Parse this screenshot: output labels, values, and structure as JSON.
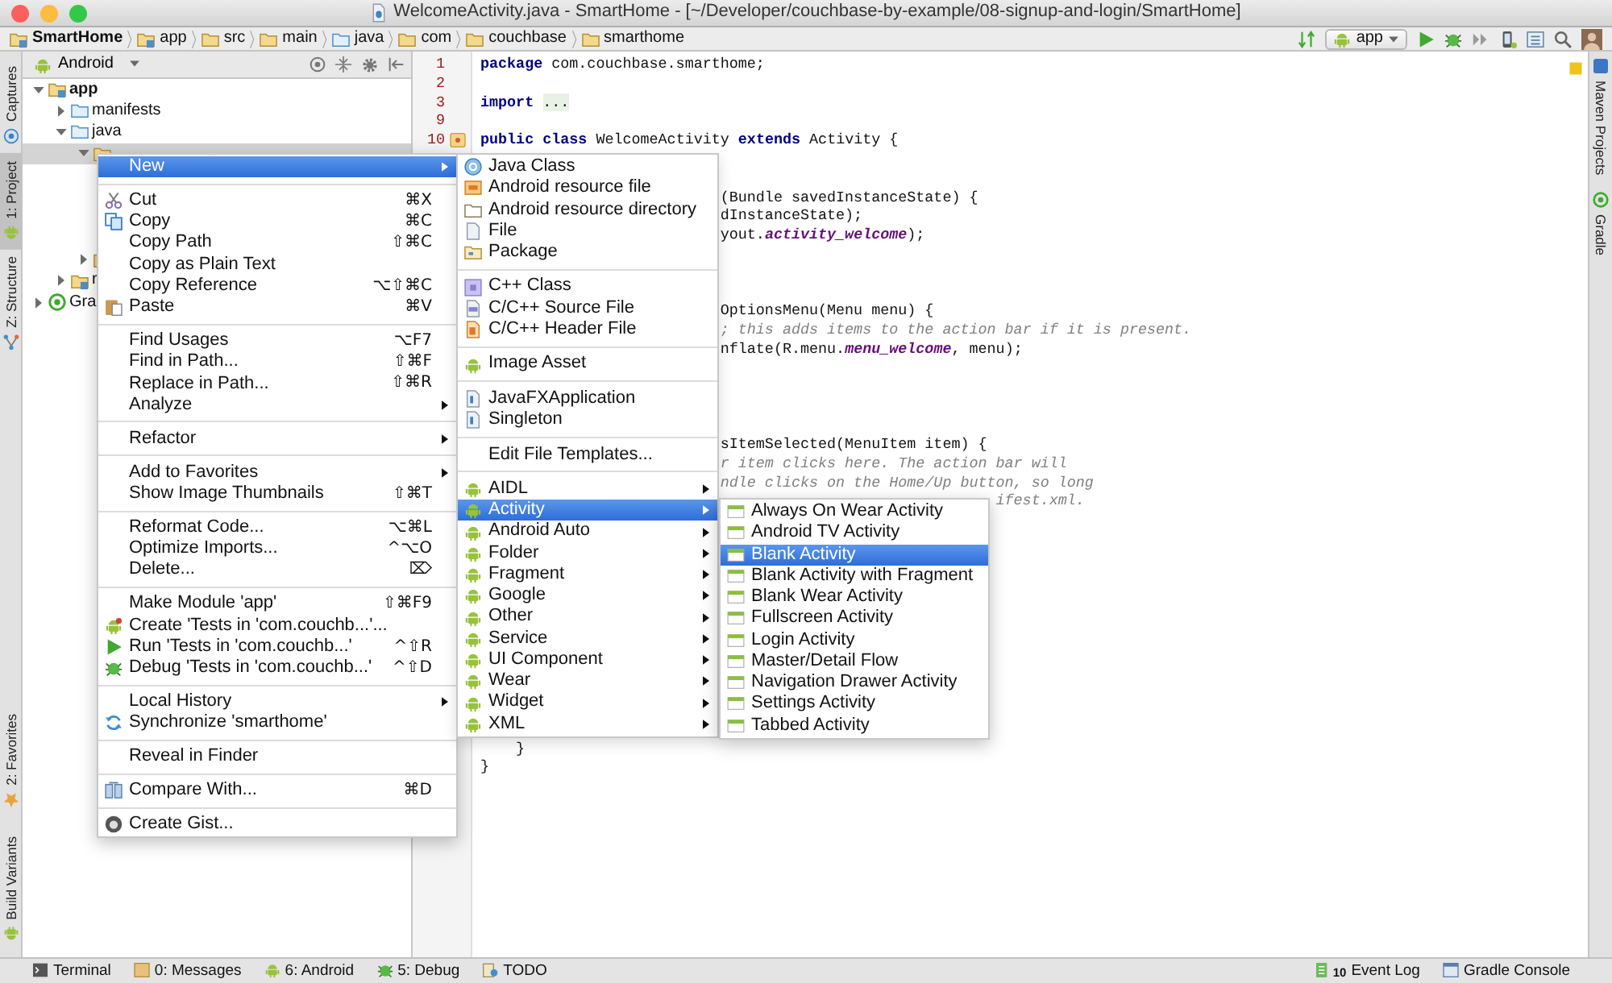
{
  "window": {
    "title": "WelcomeActivity.java - SmartHome - [~/Developer/couchbase-by-example/08-signup-and-login/SmartHome]"
  },
  "breadcrumbs": [
    {
      "label": "SmartHome",
      "kind": "project"
    },
    {
      "label": "app",
      "kind": "module"
    },
    {
      "label": "src",
      "kind": "folder"
    },
    {
      "label": "main",
      "kind": "folder"
    },
    {
      "label": "java",
      "kind": "source"
    },
    {
      "label": "com",
      "kind": "package"
    },
    {
      "label": "couchbase",
      "kind": "package"
    },
    {
      "label": "smarthome",
      "kind": "package"
    }
  ],
  "toolbar": {
    "run_configuration": "app"
  },
  "left_tool_tabs": [
    {
      "label": "Captures",
      "selected": false
    },
    {
      "label": "1: Project",
      "selected": true
    },
    {
      "label": "Z: Structure",
      "selected": false
    }
  ],
  "left_tool_tabs_lower": [
    {
      "label": "2: Favorites",
      "selected": false
    },
    {
      "label": "Build Variants",
      "selected": false
    }
  ],
  "right_tool_tabs": [
    {
      "label": "Maven Projects"
    },
    {
      "label": "Gradle"
    }
  ],
  "project_panel": {
    "view": "Android",
    "tree": [
      {
        "label": "app",
        "kind": "module",
        "expanded": true,
        "selected": false,
        "children": [
          {
            "label": "manifests",
            "kind": "folder",
            "expanded": false,
            "selected": false
          },
          {
            "label": "java",
            "kind": "folder",
            "expanded": true,
            "selected": false,
            "children": [
              {
                "kind": "package",
                "expanded": true,
                "selected": true
              },
              {
                "kind": "package",
                "expanded": false,
                "selected": false
              }
            ]
          },
          {
            "label": "r",
            "kind": "res",
            "expanded": false,
            "selected": false
          }
        ]
      },
      {
        "label": "Gra",
        "kind": "gradle",
        "expanded": false,
        "selected": false
      }
    ]
  },
  "editor": {
    "line_numbers": [
      "1",
      "2",
      "3",
      "9",
      "10"
    ],
    "lines": [
      {
        "tokens": [
          {
            "text": "package",
            "kind": "keyword"
          },
          {
            "text": " com.couchbase.smarthome;",
            "kind": "plain"
          }
        ]
      },
      {
        "tokens": [
          {
            "text": "import ",
            "kind": "keyword"
          },
          {
            "text": "...",
            "kind": "folded"
          }
        ]
      },
      {
        "tokens": [
          {
            "text": "public ",
            "kind": "keyword"
          },
          {
            "text": "class",
            "kind": "keyword"
          },
          {
            "text": " WelcomeActivity ",
            "kind": "plain"
          },
          {
            "text": "extends",
            "kind": "keyword"
          },
          {
            "text": " Activity {",
            "kind": "plain"
          }
        ]
      },
      {
        "tokens": [
          {
            "text": "(Bundle savedInstanceState) {",
            "kind": "plain"
          }
        ]
      },
      {
        "tokens": [
          {
            "text": "dInstanceState);",
            "kind": "plain"
          }
        ]
      },
      {
        "tokens": [
          {
            "text": "yout.",
            "kind": "plain"
          },
          {
            "text": "activity_welcome",
            "kind": "field"
          },
          {
            "text": ");",
            "kind": "plain"
          }
        ]
      },
      {
        "tokens": [
          {
            "text": "OptionsMenu(Menu menu) {",
            "kind": "plain"
          }
        ]
      },
      {
        "tokens": [
          {
            "text": "; this adds items to the action bar if it is present.",
            "kind": "comment"
          }
        ]
      },
      {
        "tokens": [
          {
            "text": "nflate(R.menu.",
            "kind": "plain"
          },
          {
            "text": "menu_welcome",
            "kind": "field"
          },
          {
            "text": ", menu);",
            "kind": "plain"
          }
        ]
      },
      {
        "tokens": [
          {
            "text": "sItemSelected(MenuItem item) {",
            "kind": "plain"
          }
        ]
      },
      {
        "tokens": [
          {
            "text": "r item clicks here. The action bar will",
            "kind": "comment"
          }
        ]
      },
      {
        "tokens": [
          {
            "text": "ndle clicks on the Home/Up button, so long",
            "kind": "comment"
          }
        ]
      },
      {
        "tokens": [
          {
            "text": "ifest.xml.",
            "kind": "comment"
          }
        ]
      },
      {
        "tokens": [
          {
            "text": "}",
            "kind": "plain"
          }
        ]
      },
      {
        "tokens": [
          {
            "text": "}",
            "kind": "plain"
          }
        ]
      }
    ]
  },
  "context_menu": {
    "items": [
      {
        "kind": "item",
        "label": "New",
        "submenu": true,
        "selected": true
      },
      {
        "kind": "separator"
      },
      {
        "kind": "item",
        "label": "Cut",
        "shortcut": "⌘X",
        "submenu": false,
        "selected": false
      },
      {
        "kind": "item",
        "label": "Copy",
        "shortcut": "⌘C",
        "submenu": false,
        "selected": false
      },
      {
        "kind": "item",
        "label": "Copy Path",
        "shortcut": "⇧⌘C",
        "submenu": false,
        "selected": false
      },
      {
        "kind": "item",
        "label": "Copy as Plain Text",
        "submenu": false,
        "selected": false
      },
      {
        "kind": "item",
        "label": "Copy Reference",
        "shortcut": "⌥⇧⌘C",
        "submenu": false,
        "selected": false
      },
      {
        "kind": "item",
        "label": "Paste",
        "shortcut": "⌘V",
        "submenu": false,
        "selected": false
      },
      {
        "kind": "separator"
      },
      {
        "kind": "item",
        "label": "Find Usages",
        "shortcut": "⌥F7",
        "submenu": false,
        "selected": false
      },
      {
        "kind": "item",
        "label": "Find in Path...",
        "shortcut": "⇧⌘F",
        "submenu": false,
        "selected": false
      },
      {
        "kind": "item",
        "label": "Replace in Path...",
        "shortcut": "⇧⌘R",
        "submenu": false,
        "selected": false
      },
      {
        "kind": "item",
        "label": "Analyze",
        "submenu": true,
        "selected": false
      },
      {
        "kind": "separator"
      },
      {
        "kind": "item",
        "label": "Refactor",
        "submenu": true,
        "selected": false
      },
      {
        "kind": "separator"
      },
      {
        "kind": "item",
        "label": "Add to Favorites",
        "submenu": true,
        "selected": false
      },
      {
        "kind": "item",
        "label": "Show Image Thumbnails",
        "shortcut": "⇧⌘T",
        "submenu": false,
        "selected": false
      },
      {
        "kind": "separator"
      },
      {
        "kind": "item",
        "label": "Reformat Code...",
        "shortcut": "⌥⌘L",
        "submenu": false,
        "selected": false
      },
      {
        "kind": "item",
        "label": "Optimize Imports...",
        "shortcut": "^⌥O",
        "submenu": false,
        "selected": false
      },
      {
        "kind": "item",
        "label": "Delete...",
        "shortcut": "⌦",
        "submenu": false,
        "selected": false
      },
      {
        "kind": "separator"
      },
      {
        "kind": "item",
        "label": "Make Module 'app'",
        "shortcut": "⇧⌘F9",
        "submenu": false,
        "selected": false
      },
      {
        "kind": "item",
        "label": "Create 'Tests in 'com.couchb...'...",
        "submenu": false,
        "selected": false
      },
      {
        "kind": "item",
        "label": "Run 'Tests in 'com.couchb...'",
        "shortcut": "^⇧R",
        "submenu": false,
        "selected": false
      },
      {
        "kind": "item",
        "label": "Debug 'Tests in 'com.couchb...'",
        "shortcut": "^⇧D",
        "submenu": false,
        "selected": false
      },
      {
        "kind": "separator"
      },
      {
        "kind": "item",
        "label": "Local History",
        "submenu": true,
        "selected": false
      },
      {
        "kind": "item",
        "label": "Synchronize 'smarthome'",
        "submenu": false,
        "selected": false
      },
      {
        "kind": "separator"
      },
      {
        "kind": "item",
        "label": "Reveal in Finder",
        "submenu": false,
        "selected": false
      },
      {
        "kind": "separator"
      },
      {
        "kind": "item",
        "label": "Compare With...",
        "shortcut": "⌘D",
        "submenu": false,
        "selected": false
      },
      {
        "kind": "separator"
      },
      {
        "kind": "item",
        "label": "Create Gist...",
        "submenu": false,
        "selected": false
      }
    ]
  },
  "new_submenu": {
    "items": [
      {
        "kind": "item",
        "label": "Java Class",
        "submenu": false,
        "selected": false
      },
      {
        "kind": "item",
        "label": "Android resource file",
        "submenu": false,
        "selected": false
      },
      {
        "kind": "item",
        "label": "Android resource directory",
        "submenu": false,
        "selected": false
      },
      {
        "kind": "item",
        "label": "File",
        "submenu": false,
        "selected": false
      },
      {
        "kind": "item",
        "label": "Package",
        "submenu": false,
        "selected": false
      },
      {
        "kind": "separator"
      },
      {
        "kind": "item",
        "label": "C++ Class",
        "submenu": false,
        "selected": false
      },
      {
        "kind": "item",
        "label": "C/C++ Source File",
        "submenu": false,
        "selected": false
      },
      {
        "kind": "item",
        "label": "C/C++ Header File",
        "submenu": false,
        "selected": false
      },
      {
        "kind": "separator"
      },
      {
        "kind": "item",
        "label": "Image Asset",
        "submenu": false,
        "selected": false
      },
      {
        "kind": "separator"
      },
      {
        "kind": "item",
        "label": "JavaFXApplication",
        "submenu": false,
        "selected": false
      },
      {
        "kind": "item",
        "label": "Singleton",
        "submenu": false,
        "selected": false
      },
      {
        "kind": "separator"
      },
      {
        "kind": "item",
        "label": "Edit File Templates...",
        "submenu": false,
        "selected": false
      },
      {
        "kind": "separator"
      },
      {
        "kind": "item",
        "label": "AIDL",
        "submenu": true,
        "selected": false
      },
      {
        "kind": "item",
        "label": "Activity",
        "submenu": true,
        "selected": true
      },
      {
        "kind": "item",
        "label": "Android Auto",
        "submenu": true,
        "selected": false
      },
      {
        "kind": "item",
        "label": "Folder",
        "submenu": true,
        "selected": false
      },
      {
        "kind": "item",
        "label": "Fragment",
        "submenu": true,
        "selected": false
      },
      {
        "kind": "item",
        "label": "Google",
        "submenu": true,
        "selected": false
      },
      {
        "kind": "item",
        "label": "Other",
        "submenu": true,
        "selected": false
      },
      {
        "kind": "item",
        "label": "Service",
        "submenu": true,
        "selected": false
      },
      {
        "kind": "item",
        "label": "UI Component",
        "submenu": true,
        "selected": false
      },
      {
        "kind": "item",
        "label": "Wear",
        "submenu": true,
        "selected": false
      },
      {
        "kind": "item",
        "label": "Widget",
        "submenu": true,
        "selected": false
      },
      {
        "kind": "item",
        "label": "XML",
        "submenu": true,
        "selected": false
      }
    ]
  },
  "activity_submenu": {
    "items": [
      {
        "kind": "item",
        "label": "Always On Wear Activity",
        "submenu": false,
        "selected": false
      },
      {
        "kind": "item",
        "label": "Android TV Activity",
        "submenu": false,
        "selected": false
      },
      {
        "kind": "item",
        "label": "Blank Activity",
        "submenu": false,
        "selected": true
      },
      {
        "kind": "item",
        "label": "Blank Activity with Fragment",
        "submenu": false,
        "selected": false
      },
      {
        "kind": "item",
        "label": "Blank Wear Activity",
        "submenu": false,
        "selected": false
      },
      {
        "kind": "item",
        "label": "Fullscreen Activity",
        "submenu": false,
        "selected": false
      },
      {
        "kind": "item",
        "label": "Login Activity",
        "submenu": false,
        "selected": false
      },
      {
        "kind": "item",
        "label": "Master/Detail Flow",
        "submenu": false,
        "selected": false
      },
      {
        "kind": "item",
        "label": "Navigation Drawer Activity",
        "submenu": false,
        "selected": false
      },
      {
        "kind": "item",
        "label": "Settings Activity",
        "submenu": false,
        "selected": false
      },
      {
        "kind": "item",
        "label": "Tabbed Activity",
        "submenu": false,
        "selected": false
      }
    ]
  },
  "status_bar": {
    "left": [
      {
        "label": "Terminal"
      },
      {
        "label": "0: Messages"
      },
      {
        "label": "6: Android"
      },
      {
        "label": "5: Debug"
      },
      {
        "label": "TODO"
      }
    ],
    "right": [
      {
        "label": "Event Log",
        "count": "10"
      },
      {
        "label": "Gradle Console"
      }
    ]
  }
}
